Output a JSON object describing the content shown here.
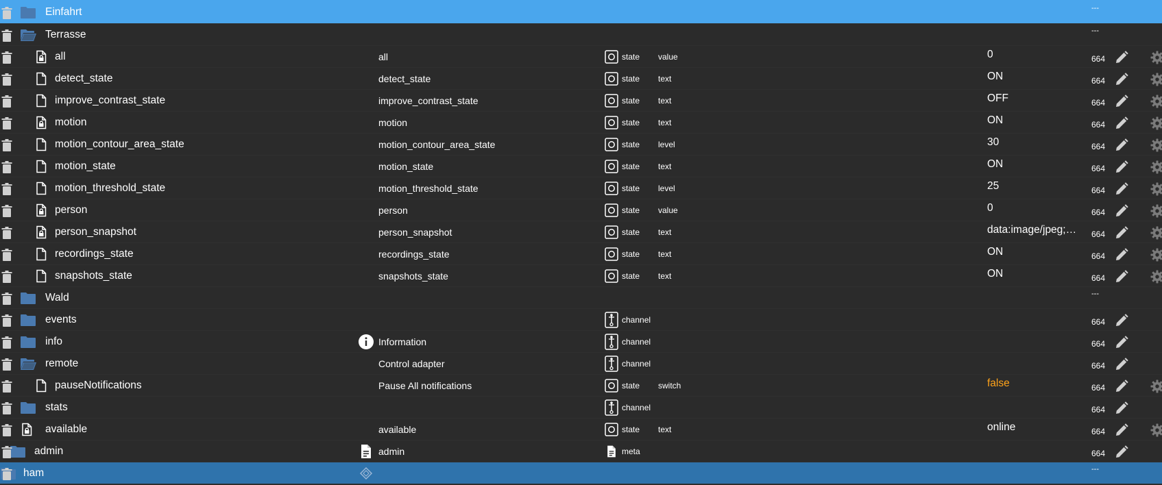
{
  "colors": {
    "selected_light": "#4aa6ed",
    "selected_dark": "#2f73ac",
    "background": "#2b2b2b",
    "folder": "#4a7ab0",
    "value_false": "#ffa31a"
  },
  "rows": [
    {
      "name": "Einfahrt",
      "icon": "folder-closed-icon",
      "level": 1,
      "acl": "---",
      "actions": [
        "delete"
      ],
      "highlight": "light"
    },
    {
      "name": "Terrasse",
      "icon": "folder-open-icon",
      "level": 1,
      "acl": "---",
      "actions": [
        "delete"
      ]
    },
    {
      "name": "all",
      "icon": "file-lock-icon",
      "level": 2,
      "desc": "all",
      "type": "state",
      "role": "value",
      "value": "0",
      "acl": "664",
      "actions": [
        "edit",
        "delete",
        "gear"
      ]
    },
    {
      "name": "detect_state",
      "icon": "file-icon",
      "level": 2,
      "desc": "detect_state",
      "type": "state",
      "role": "text",
      "value": "ON",
      "acl": "664",
      "actions": [
        "edit",
        "delete",
        "gear"
      ]
    },
    {
      "name": "improve_contrast_state",
      "icon": "file-icon",
      "level": 2,
      "desc": "improve_contrast_state",
      "type": "state",
      "role": "text",
      "value": "OFF",
      "acl": "664",
      "actions": [
        "edit",
        "delete",
        "gear"
      ]
    },
    {
      "name": "motion",
      "icon": "file-lock-icon",
      "level": 2,
      "desc": "motion",
      "type": "state",
      "role": "text",
      "value": "ON",
      "acl": "664",
      "actions": [
        "edit",
        "delete",
        "gear"
      ]
    },
    {
      "name": "motion_contour_area_state",
      "icon": "file-icon",
      "level": 2,
      "desc": "motion_contour_area_state",
      "type": "state",
      "role": "level",
      "value": "30",
      "acl": "664",
      "actions": [
        "edit",
        "delete",
        "gear"
      ]
    },
    {
      "name": "motion_state",
      "icon": "file-icon",
      "level": 2,
      "desc": "motion_state",
      "type": "state",
      "role": "text",
      "value": "ON",
      "acl": "664",
      "actions": [
        "edit",
        "delete",
        "gear"
      ]
    },
    {
      "name": "motion_threshold_state",
      "icon": "file-icon",
      "level": 2,
      "desc": "motion_threshold_state",
      "type": "state",
      "role": "level",
      "value": "25",
      "acl": "664",
      "actions": [
        "edit",
        "delete",
        "gear"
      ]
    },
    {
      "name": "person",
      "icon": "file-lock-icon",
      "level": 2,
      "desc": "person",
      "type": "state",
      "role": "value",
      "value": "0",
      "acl": "664",
      "actions": [
        "edit",
        "delete",
        "gear"
      ]
    },
    {
      "name": "person_snapshot",
      "icon": "file-lock-icon",
      "level": 2,
      "desc": "person_snapshot",
      "type": "state",
      "role": "text",
      "value": "data:image/jpeg;…",
      "acl": "664",
      "actions": [
        "edit",
        "delete",
        "gear"
      ]
    },
    {
      "name": "recordings_state",
      "icon": "file-icon",
      "level": 2,
      "desc": "recordings_state",
      "type": "state",
      "role": "text",
      "value": "ON",
      "acl": "664",
      "actions": [
        "edit",
        "delete",
        "gear"
      ]
    },
    {
      "name": "snapshots_state",
      "icon": "file-icon",
      "level": 2,
      "desc": "snapshots_state",
      "type": "state",
      "role": "text",
      "value": "ON",
      "acl": "664",
      "actions": [
        "edit",
        "delete",
        "gear"
      ]
    },
    {
      "name": "Wald",
      "icon": "folder-closed-icon",
      "level": 1,
      "acl": "---",
      "actions": [
        "delete"
      ]
    },
    {
      "name": "events",
      "icon": "folder-closed-icon",
      "level": 1,
      "type": "channel",
      "acl": "664",
      "actions": [
        "edit",
        "delete"
      ]
    },
    {
      "name": "info",
      "icon": "folder-closed-icon",
      "level": 1,
      "desc": "Information",
      "desc_icon": "info-circle-icon",
      "type": "channel",
      "acl": "664",
      "actions": [
        "edit",
        "delete"
      ]
    },
    {
      "name": "remote",
      "icon": "folder-open-icon",
      "level": 1,
      "desc": "Control adapter",
      "type": "channel",
      "acl": "664",
      "actions": [
        "edit",
        "delete"
      ]
    },
    {
      "name": "pauseNotifications",
      "icon": "file-icon",
      "level": 2,
      "desc": "Pause All notifications",
      "type": "state",
      "role": "switch",
      "value": "false",
      "value_style": "orange",
      "acl": "664",
      "actions": [
        "edit",
        "delete",
        "gear"
      ]
    },
    {
      "name": "stats",
      "icon": "folder-closed-icon",
      "level": 1,
      "type": "channel",
      "acl": "664",
      "actions": [
        "edit",
        "delete"
      ]
    },
    {
      "name": "available",
      "icon": "file-lock-icon",
      "level": 1,
      "desc": "available",
      "type": "state",
      "role": "text",
      "value": "online",
      "acl": "664",
      "actions": [
        "edit",
        "delete",
        "gear"
      ]
    },
    {
      "name": "admin",
      "icon": "folder-closed-icon",
      "level": 0,
      "desc": "admin",
      "desc_icon": "document-icon",
      "type": "meta",
      "acl": "664",
      "actions": [
        "edit",
        "delete"
      ]
    },
    {
      "name": "ham",
      "icon": "folder-closed-icon",
      "level": -1,
      "desc_icon": "puzzle-icon",
      "acl": "---",
      "actions": [
        "delete"
      ],
      "highlight": "dark"
    }
  ]
}
